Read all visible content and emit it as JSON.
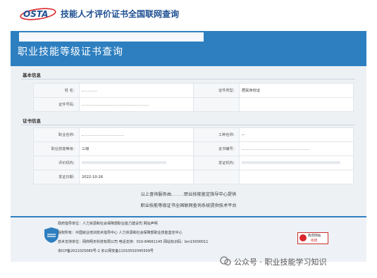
{
  "header": {
    "logo_text": "OSTA",
    "title": "技能人才评价证书全国联网查询"
  },
  "banner": {
    "title": "职业技能等级证书查询"
  },
  "basic_info": {
    "heading": "基本信息",
    "name_label": "姓 名：",
    "cert_type_label": "证件类型：",
    "cert_type_value": "居民身份证",
    "id_number_label": "证件号码："
  },
  "certificate_info": {
    "heading": "证书信息",
    "occupation_label": "职业名称：",
    "job_type_label": "工种名称：",
    "job_type_value": "--",
    "level_label": "职业技能等级：",
    "level_value": "三级",
    "cert_number_label": "证书编号：",
    "eval_org_label": "评价机构：",
    "issuing_org_label": "发证机构：",
    "issue_date_label": "发证日期：",
    "issue_date_value": "2022-10-26"
  },
  "note": {
    "line1_prefix": "以上查询服务由",
    "line1_suffix": "职业技能鉴定指导中心提供",
    "line2": "职业技能等级证书全国联网查询系统提供技术平台"
  },
  "footer": {
    "line1": "政府指导单位：人力资源和社会保障部职业能力建设司         网站声明",
    "line2": "版权所有：中国就业培训技术指导中心  人力资源和社会保障部职业技能鉴定中心",
    "line3": "技术支持单位：网商明天科技有限公司   电话支持：010-84661145  网站标识码：bm15000011",
    "line4": "京ICP备2021025080号-2   京公网安备11010502045509号",
    "badge_right_line1": "政府网站",
    "badge_right_line2": "找错"
  },
  "watermark": {
    "text": "公众号 · 职业技能学习知识"
  },
  "colors": {
    "brand_blue": "#2e7fc0",
    "content_bg": "#eef1f4"
  }
}
